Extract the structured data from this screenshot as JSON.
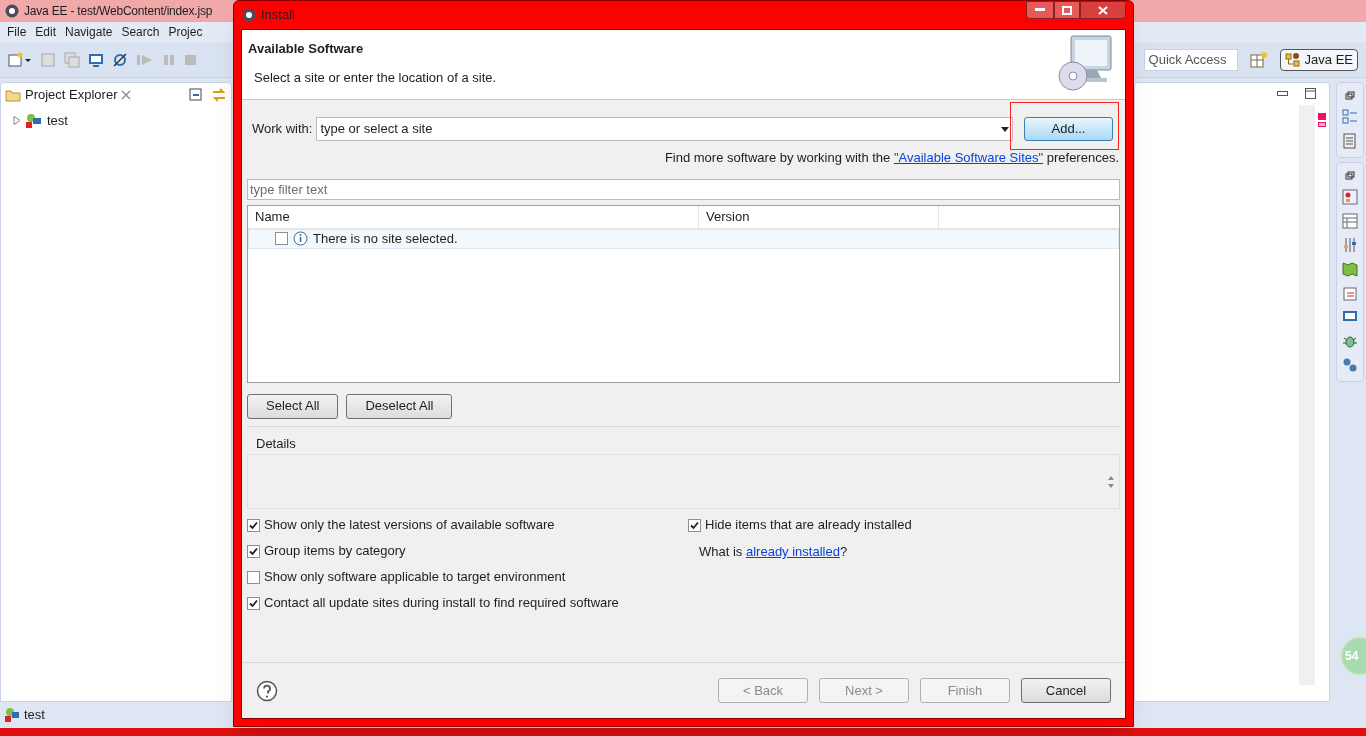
{
  "ide": {
    "title": "Java EE - test/WebContent/index.jsp",
    "menu": [
      "File",
      "Edit",
      "Navigate",
      "Search",
      "Projec"
    ],
    "quick_access": {
      "placeholder": "Quick Access"
    },
    "perspective": {
      "label": "Java EE",
      "selected": true
    },
    "project_explorer": {
      "title": "Project Explorer",
      "items": [
        {
          "label": "test",
          "expanded": false
        }
      ]
    },
    "status_bar": "test",
    "badge": "54"
  },
  "dialog": {
    "title": "Install",
    "heading": "Available Software",
    "description": "Select a site or enter the location of a site.",
    "work_with": {
      "label": "Work with:",
      "value": "type or select a site"
    },
    "add_button": "Add...",
    "find_more": {
      "before": "Find more software by working with the",
      "link": "\"Available Software Sites\"",
      "after": "preferences."
    },
    "filter": {
      "placeholder": "type filter text"
    },
    "table": {
      "columns": [
        "Name",
        "Version"
      ],
      "rows": [
        {
          "text": "There is no site selected.",
          "checked": false
        }
      ]
    },
    "select_buttons": [
      "Select All",
      "Deselect All"
    ],
    "details_label": "Details",
    "options_left": [
      {
        "label": "Show only the latest versions of available software",
        "checked": true
      },
      {
        "label": "Group items by category",
        "checked": true
      },
      {
        "label": "Show only software applicable to target environment",
        "checked": false
      },
      {
        "label": "Contact all update sites during install to find required software",
        "checked": true
      }
    ],
    "options_right": [
      {
        "label": "Hide items that are already installed",
        "checked": true
      }
    ],
    "installed_note": {
      "before": "What is",
      "link": "already installed",
      "after": "?"
    },
    "footer_buttons": [
      {
        "label": "< Back",
        "disabled": true
      },
      {
        "label": "Next >",
        "disabled": true
      },
      {
        "label": "Finish",
        "disabled": true
      },
      {
        "label": "Cancel",
        "disabled": false
      }
    ]
  }
}
